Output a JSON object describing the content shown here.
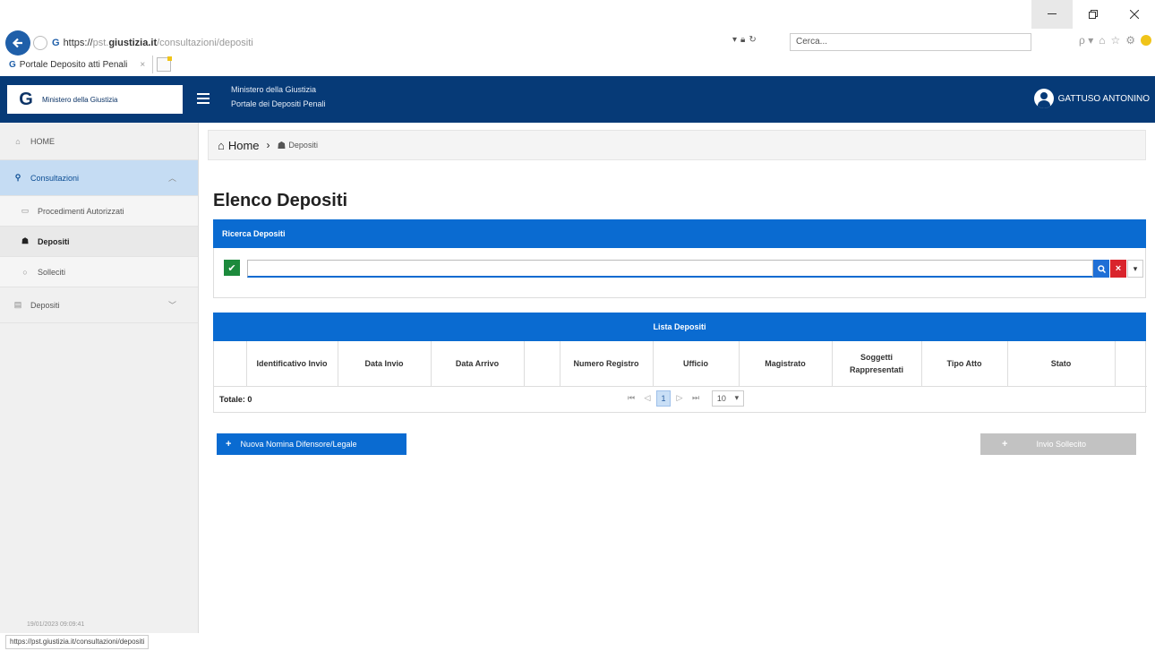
{
  "browser": {
    "url_protocol": "https://",
    "url_host_prefix": "pst.",
    "url_host_main": "giustizia.it",
    "url_path": "/consultazioni/depositi",
    "search_placeholder": "Cerca...",
    "search_icon_text": "ρ ▾",
    "tab_title": "Portale Deposito atti Penali",
    "status_url": "https://pst.giustizia.it/consultazioni/depositi"
  },
  "header": {
    "logo_text": "Ministero della Giustizia",
    "title_line1": "Ministero della Giustizia",
    "title_line2": "Portale dei Depositi Penali",
    "user_name": "GATTUSO ANTONINO"
  },
  "sidebar": {
    "home": "HOME",
    "consultazioni": "Consultazioni",
    "sub_items": [
      "Procedimenti Autorizzati",
      "Depositi",
      "Solleciti"
    ],
    "depositi_group": "Depositi",
    "footer": "19/01/2023 09:09:41"
  },
  "breadcrumb": {
    "home": "Home",
    "current": "Depositi"
  },
  "page": {
    "title": "Elenco Depositi"
  },
  "search": {
    "panel_title": "Ricerca Depositi",
    "value": ""
  },
  "table": {
    "panel_title": "Lista Depositi",
    "columns": [
      "",
      "Identificativo Invio",
      "Data Invio",
      "Data Arrivo",
      "",
      "Numero Registro",
      "Ufficio",
      "Magistrato",
      "Soggetti Rappresentati",
      "Tipo Atto",
      "Stato",
      ""
    ],
    "total_label": "Totale: 0",
    "current_page": "1",
    "page_size": "10"
  },
  "actions": {
    "new_nomina": "Nuova Nomina Difensore/Legale",
    "invio_sollecito": "Invio Sollecito"
  },
  "colors": {
    "header_blue": "#063a77",
    "panel_blue": "#0a6bd1",
    "danger": "#d9242c",
    "success": "#1c8a3c"
  }
}
